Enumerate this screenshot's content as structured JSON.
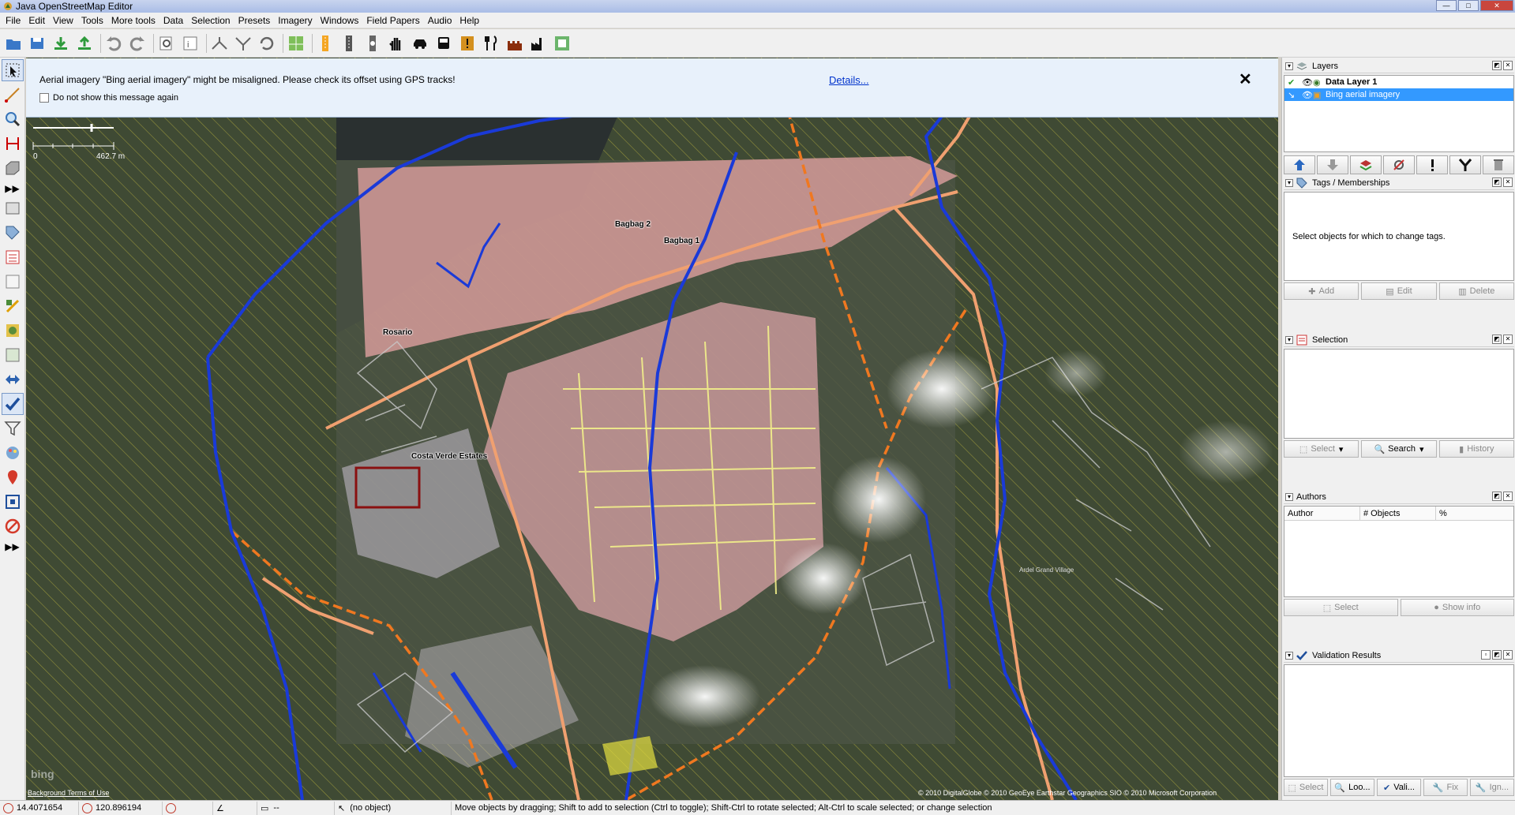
{
  "window": {
    "title": "Java OpenStreetMap Editor"
  },
  "menu": [
    "File",
    "Edit",
    "View",
    "Tools",
    "More tools",
    "Data",
    "Selection",
    "Presets",
    "Imagery",
    "Windows",
    "Field Papers",
    "Audio",
    "Help"
  ],
  "notice": {
    "message": "Aerial imagery \"Bing aerial imagery\" might be misaligned. Please check its offset using GPS tracks!",
    "checkbox_label": "Do not show this message again",
    "details_link": "Details...",
    "close": "✕"
  },
  "scale": {
    "zero": "0",
    "distance": "462.7 m"
  },
  "places": [
    {
      "name": "Bagbag 2"
    },
    {
      "name": "Bagbag 1"
    },
    {
      "name": "Rosario"
    },
    {
      "name": "Costa Verde Estates"
    },
    {
      "name": "Ardel Grand Village"
    }
  ],
  "map": {
    "attribution": "© 2010 DigitalGlobe © 2010 GeoEye Earthstar Geographics SIO © 2010 Microsoft Corporation",
    "background_terms": "Background Terms of Use",
    "bing": "bing"
  },
  "layers": {
    "title": "Layers",
    "items": [
      {
        "name": "Data Layer 1",
        "selected": false
      },
      {
        "name": "Bing aerial imagery",
        "selected": true
      }
    ]
  },
  "tags": {
    "title": "Tags / Memberships",
    "empty": "Select objects for which to change tags.",
    "buttons": [
      "Add",
      "Edit",
      "Delete"
    ]
  },
  "selection": {
    "title": "Selection",
    "buttons": [
      "Select",
      "Search",
      "History"
    ]
  },
  "authors": {
    "title": "Authors",
    "columns": [
      "Author",
      "# Objects",
      "%"
    ],
    "buttons": [
      "Select",
      "Show info"
    ]
  },
  "validation": {
    "title": "Validation Results",
    "buttons": [
      "Select",
      "Loo...",
      "Vali...",
      "Fix",
      "Ign..."
    ]
  },
  "status": {
    "lat": "14.4071654",
    "lon": "120.896194",
    "dist": "--",
    "object": "(no object)",
    "help": "Move objects by dragging; Shift to add to selection (Ctrl to toggle); Shift-Ctrl to rotate selected; Alt-Ctrl to scale selected; or change selection"
  },
  "colors": {
    "accent": "#3399ff",
    "road_primary": "#f0a070",
    "waterway": "#1a3ad8",
    "landuse": "#f2b4b4"
  }
}
